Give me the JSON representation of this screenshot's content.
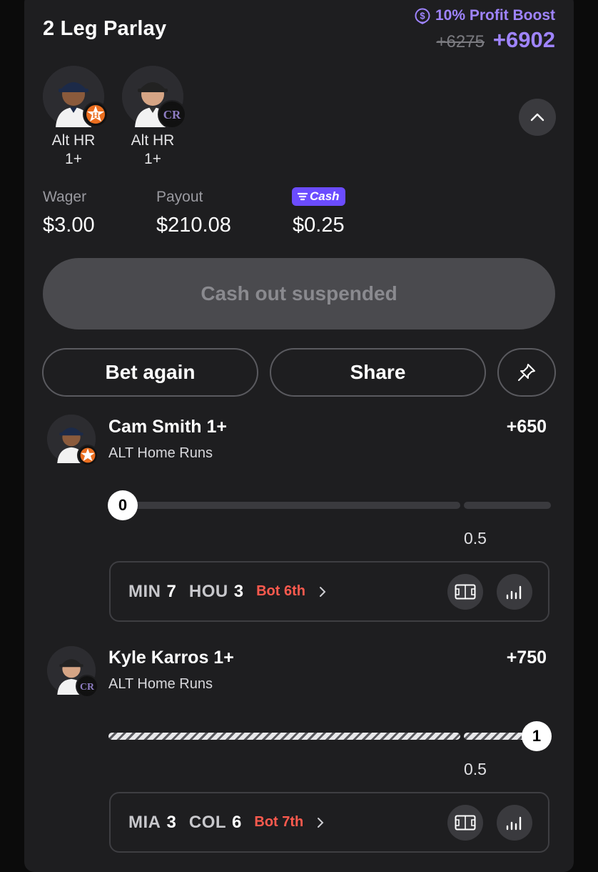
{
  "parlay": {
    "title": "2 Leg Parlay",
    "boost_label": "10% Profit Boost",
    "old_odds": "+6275",
    "new_odds": "+6902"
  },
  "legs_summary": [
    {
      "label_line1": "Alt HR",
      "label_line2": "1+"
    },
    {
      "label_line1": "Alt HR",
      "label_line2": "1+"
    }
  ],
  "stats": {
    "wager_label": "Wager",
    "wager_value": "$3.00",
    "payout_label": "Payout",
    "payout_value": "$210.08",
    "cash_badge": "Cash",
    "cash_value": "$0.25"
  },
  "actions": {
    "cashout_label": "Cash out suspended",
    "bet_again_label": "Bet again",
    "share_label": "Share"
  },
  "legs": [
    {
      "player": "Cam Smith 1+",
      "market": "ALT Home Runs",
      "odds": "+650",
      "current": "0",
      "threshold": "0.5",
      "progress": 0,
      "game": {
        "away": "MIN",
        "away_score": "7",
        "home": "HOU",
        "home_score": "3",
        "status": "Bot 6th"
      }
    },
    {
      "player": "Kyle Karros 1+",
      "market": "ALT Home Runs",
      "odds": "+750",
      "current": "1",
      "threshold": "0.5",
      "progress": 1,
      "game": {
        "away": "MIA",
        "away_score": "3",
        "home": "COL",
        "home_score": "6",
        "status": "Bot 7th"
      }
    }
  ],
  "colors": {
    "accent": "#9f84ff",
    "live": "#ff5a4e",
    "fcash": "#6b4cff",
    "card": "#1e1e20"
  },
  "icons": [
    "profit-boost-icon",
    "chevron-up-icon",
    "pin-icon",
    "field-icon",
    "stats-icon",
    "chevron-right-icon"
  ]
}
